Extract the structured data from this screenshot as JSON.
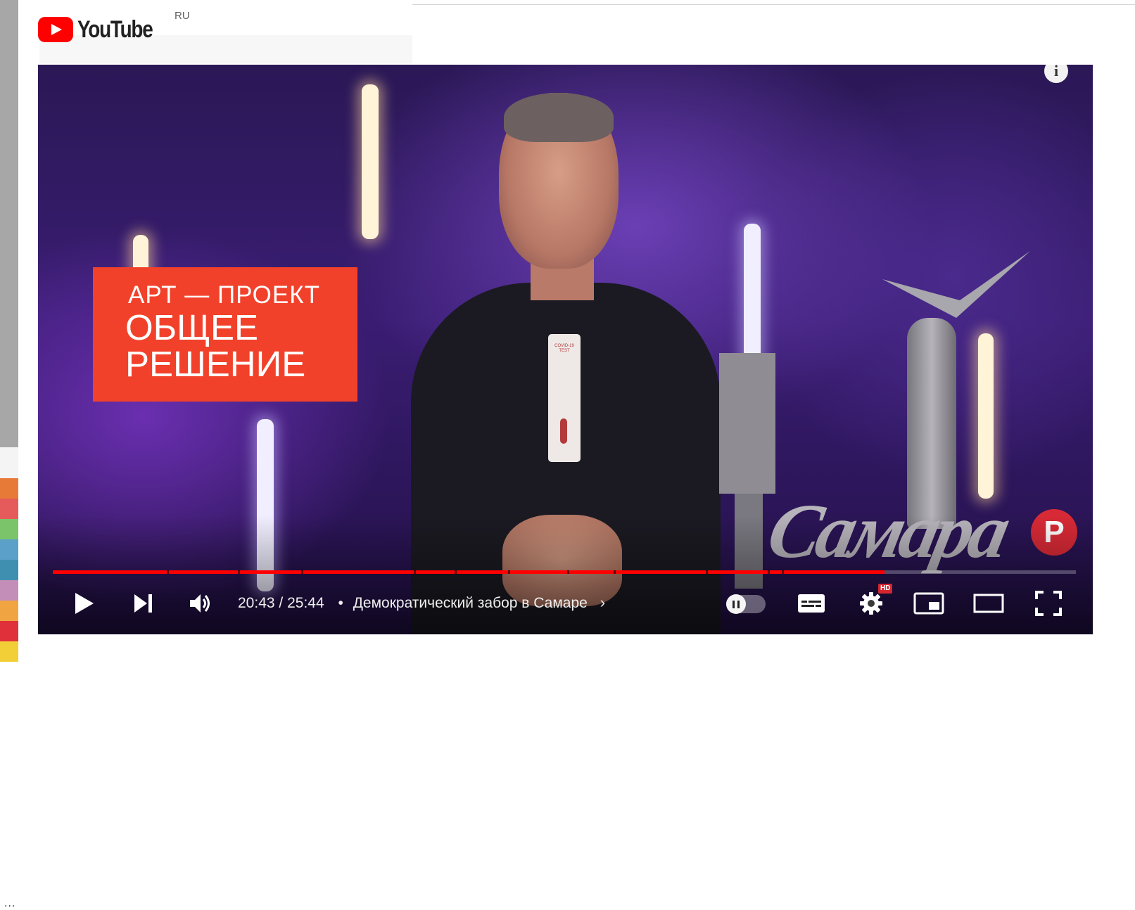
{
  "header": {
    "logo_text": "YouTube",
    "region": "RU"
  },
  "left_strip": {
    "more_label": "...",
    "swatches": [
      "#e87a38",
      "#e55a5a",
      "#7bc46a",
      "#5aa0c8",
      "#3f8fb0",
      "#c38fb8",
      "#f0a542",
      "#e0303a",
      "#f2cf36"
    ]
  },
  "overlay": {
    "art_line1": "АРТ — ПРОЕКТ",
    "art_line2": "ОБЩЕЕ",
    "art_line3": "РЕШЕНИЕ",
    "test_label": "COVID-19 TEST",
    "watermark_text": "Самара",
    "channel_badge": "Р",
    "info_label": "i"
  },
  "player": {
    "progress_fraction": 0.813,
    "current_time": "20:43",
    "duration": "25:44",
    "time_separator": "/",
    "bullet": "•",
    "chapter_title": "Демократический забор в Самаре",
    "chapter_chevron": "›",
    "hd_badge": "HD",
    "accent_color": "#ff0000"
  }
}
